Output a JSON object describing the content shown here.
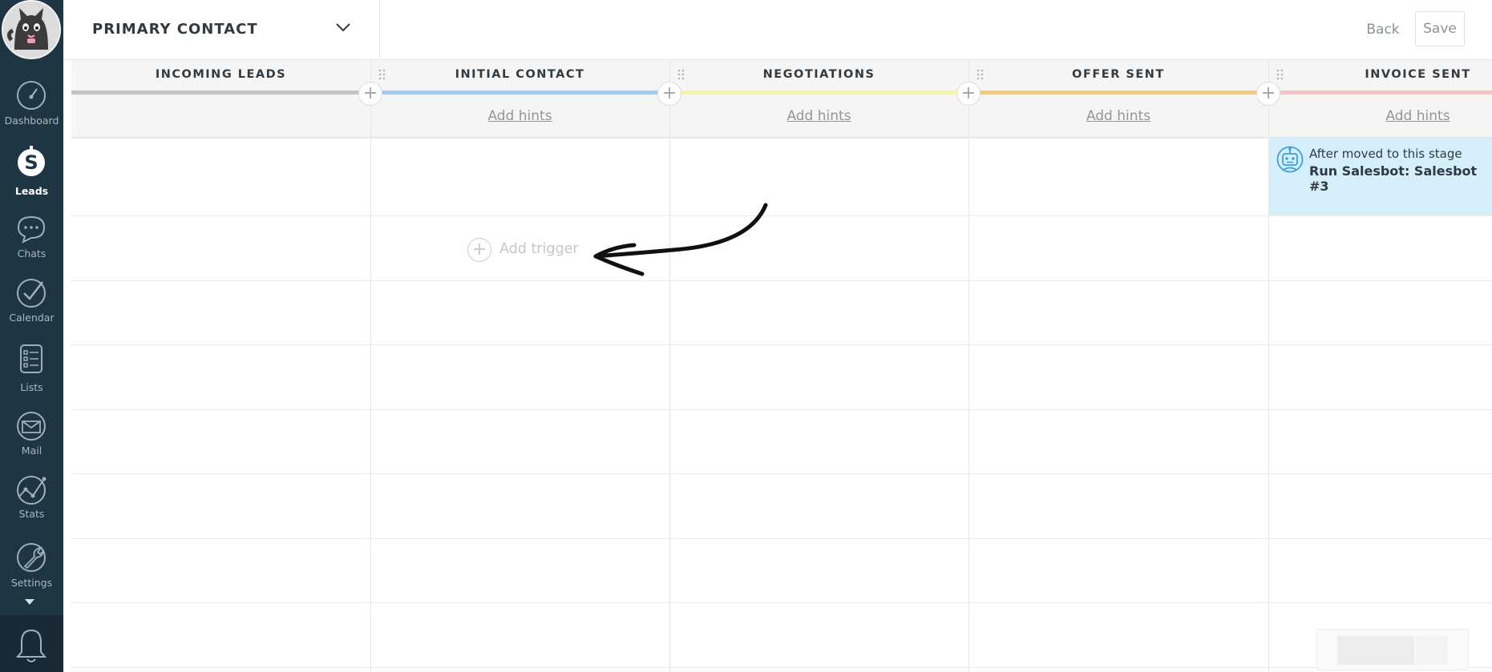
{
  "header": {
    "pipeline_title": "PRIMARY CONTACT",
    "back_label": "Back",
    "save_label": "Save"
  },
  "sidebar": {
    "items": [
      {
        "label": "Dashboard",
        "icon": "dashboard-gauge-icon"
      },
      {
        "label": "Leads",
        "icon": "leads-dollar-icon",
        "active": true
      },
      {
        "label": "Chats",
        "icon": "chat-bubble-icon"
      },
      {
        "label": "Calendar",
        "icon": "checkmark-circle-icon"
      },
      {
        "label": "Lists",
        "icon": "list-icon"
      },
      {
        "label": "Mail",
        "icon": "mail-envelope-icon"
      },
      {
        "label": "Stats",
        "icon": "stats-graph-icon"
      },
      {
        "label": "Settings",
        "icon": "wrench-icon"
      }
    ]
  },
  "stages": [
    {
      "title": "INCOMING LEADS",
      "color": "#c4c4c4",
      "hints": ""
    },
    {
      "title": "INITIAL CONTACT",
      "color": "#9dcbf7",
      "hints": "Add hints"
    },
    {
      "title": "NEGOTIATIONS",
      "color": "#fbf49a",
      "hints": "Add hints"
    },
    {
      "title": "OFFER SENT",
      "color": "#fbc86a",
      "hints": "Add hints"
    },
    {
      "title": "INVOICE SENT",
      "color": "#f9c2bd",
      "hints": "Add hints"
    }
  ],
  "trigger": {
    "line1": "After moved to this stage",
    "line2": "Run Salesbot: Salesbot #3"
  },
  "add_trigger_label": "Add trigger"
}
